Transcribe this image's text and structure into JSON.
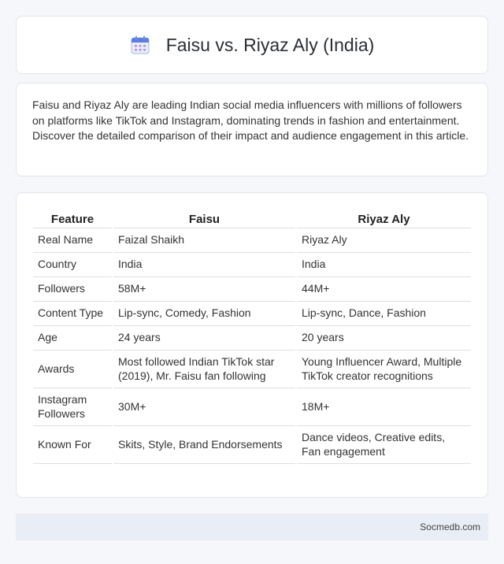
{
  "header": {
    "icon": "calendar-icon",
    "title": "Faisu vs. Riyaz Aly (India)"
  },
  "intro": {
    "text": "Faisu and Riyaz Aly are leading Indian social media influencers with millions of followers on platforms like TikTok and Instagram, dominating trends in fashion and entertainment. Discover the detailed comparison of their impact and audience engagement in this article."
  },
  "table": {
    "headers": [
      "Feature",
      "Faisu",
      "Riyaz Aly"
    ],
    "rows": [
      [
        "Real Name",
        "Faizal Shaikh",
        "Riyaz Aly"
      ],
      [
        "Country",
        "India",
        "India"
      ],
      [
        "Followers",
        "58M+",
        "44M+"
      ],
      [
        "Content Type",
        "Lip-sync, Comedy, Fashion",
        "Lip-sync, Dance, Fashion"
      ],
      [
        "Age",
        "24 years",
        "20 years"
      ],
      [
        "Awards",
        "Most followed Indian TikTok star (2019), Mr. Faisu fan following",
        "Young Influencer Award, Multiple TikTok creator recognitions"
      ],
      [
        "Instagram Followers",
        "30M+",
        "18M+"
      ],
      [
        "Known For",
        "Skits, Style, Brand Endorsements",
        "Dance videos, Creative edits, Fan engagement"
      ]
    ]
  },
  "footer": {
    "text": "Socmedb.com"
  },
  "colors": {
    "background": "#f6f7fb",
    "card": "#ffffff",
    "footer": "#e8edf6",
    "icon_accent": "#5b7fe0"
  }
}
